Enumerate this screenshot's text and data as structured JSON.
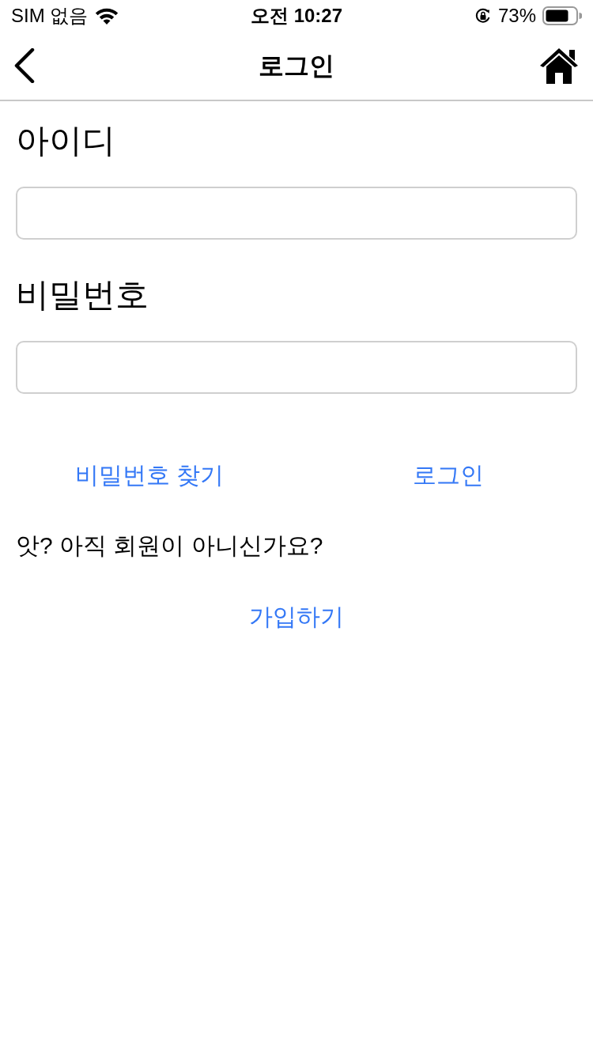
{
  "status_bar": {
    "carrier": "SIM 없음",
    "time": "오전 10:27",
    "battery": "73%"
  },
  "nav_bar": {
    "title": "로그인"
  },
  "form": {
    "fields": [
      {
        "label": "아이디"
      },
      {
        "label": "비밀번호"
      }
    ]
  },
  "links": [
    {
      "label": "비밀번호 찾기"
    },
    {
      "label": "로그인"
    }
  ],
  "signup_prompt": "앗? 아직 회원이 아니신가요?",
  "signup_link": "가입하기"
}
